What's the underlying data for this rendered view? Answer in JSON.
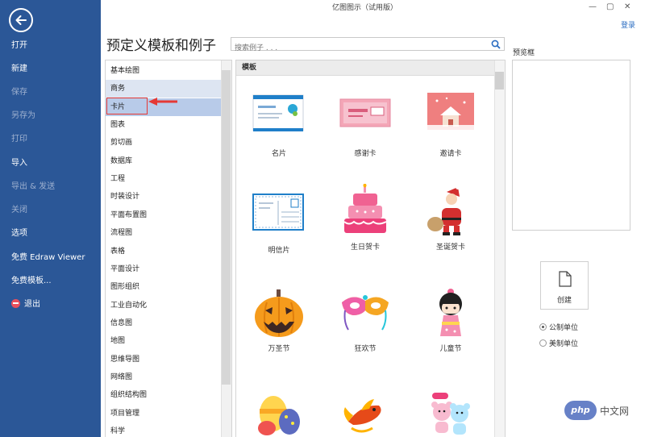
{
  "window": {
    "title": "亿图图示（试用版）",
    "login": "登录"
  },
  "nav": {
    "items": [
      {
        "label": "打开",
        "dim": false
      },
      {
        "label": "新建",
        "dim": false
      },
      {
        "label": "保存",
        "dim": true
      },
      {
        "label": "另存为",
        "dim": true
      },
      {
        "label": "打印",
        "dim": true
      },
      {
        "label": "导入",
        "dim": false
      },
      {
        "label": "导出 & 发送",
        "dim": true
      },
      {
        "label": "关闭",
        "dim": true
      },
      {
        "label": "选项",
        "dim": false
      },
      {
        "label": "免费 Edraw Viewer",
        "dim": false
      },
      {
        "label": "免费模板...",
        "dim": false
      },
      {
        "label": "退出",
        "dim": false
      }
    ]
  },
  "main": {
    "heading": "预定义模板和例子",
    "search_placeholder": "搜索例子 . . ."
  },
  "categories": [
    "基本绘图",
    "商务",
    "卡片",
    "图表",
    "剪切画",
    "数据库",
    "工程",
    "时装设计",
    "平面布置图",
    "流程图",
    "表格",
    "平面设计",
    "图形组织",
    "工业自动化",
    "信息图",
    "地图",
    "思维导图",
    "网络图",
    "组织结构图",
    "项目管理",
    "科学"
  ],
  "selected_category": "卡片",
  "templates": {
    "section_title": "模板",
    "items": [
      "名片",
      "感谢卡",
      "邀请卡",
      "明信片",
      "生日贺卡",
      "圣诞贺卡",
      "万圣节",
      "狂欢节",
      "儿童节"
    ]
  },
  "preview": {
    "label": "预览框",
    "create_label": "创建",
    "unit_metric": "公制单位",
    "unit_us": "美制单位"
  },
  "watermark": {
    "logo": "php",
    "text": "中文网"
  },
  "colors": {
    "nav_bg": "#2b5797",
    "selection": "#b8cbe9",
    "accent_red": "#e53935"
  }
}
